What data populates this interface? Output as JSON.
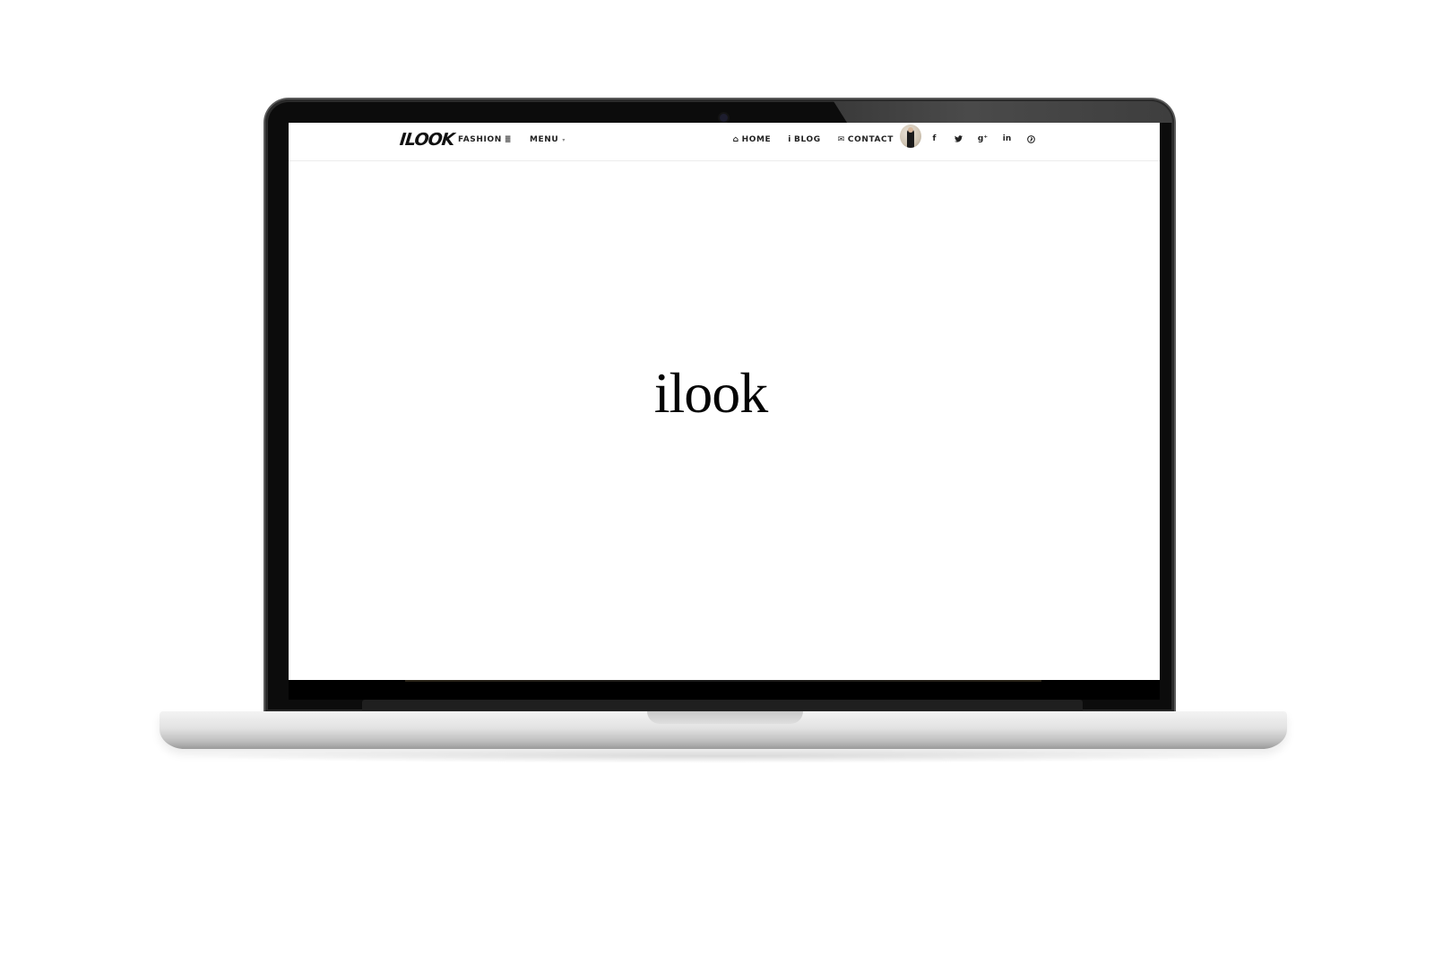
{
  "site": {
    "logo_text": "ILOOK",
    "hero_text": "ilook"
  },
  "nav_left": [
    {
      "label": "FASHION",
      "icon": "bars-icon",
      "glyph": "≣"
    },
    {
      "label": "MENU",
      "icon": "caret-down-icon",
      "glyph": "▾"
    }
  ],
  "nav_right": [
    {
      "label": "HOME",
      "icon": "home-icon",
      "glyph": "⌂"
    },
    {
      "label": "BLOG",
      "icon": "info-icon",
      "glyph": "i"
    },
    {
      "label": "CONTACT",
      "icon": "envelope-icon",
      "glyph": "✉"
    }
  ],
  "socials": [
    {
      "name": "facebook-icon",
      "glyph": "f"
    },
    {
      "name": "twitter-icon",
      "glyph": "t"
    },
    {
      "name": "google-plus-icon",
      "glyph": "g⁺"
    },
    {
      "name": "linkedin-icon",
      "glyph": "in"
    },
    {
      "name": "pinterest-icon",
      "glyph": "℗"
    }
  ],
  "colors": {
    "text": "#222222",
    "background": "#ffffff",
    "bezel": "#0c0c0c"
  }
}
